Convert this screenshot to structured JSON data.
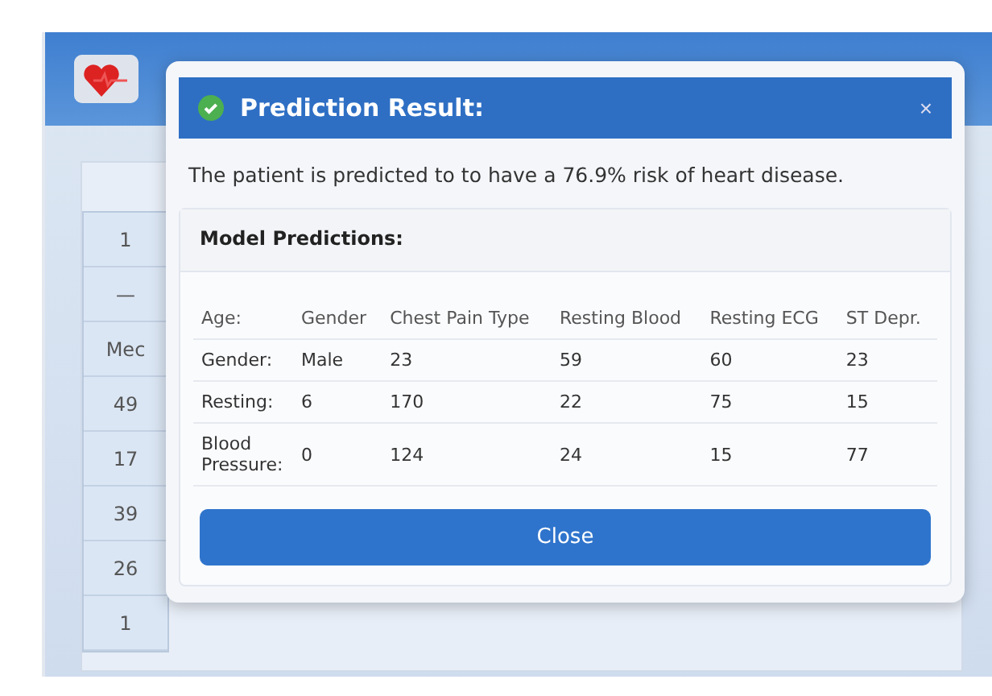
{
  "background_table": {
    "cells": [
      "1",
      "—",
      "Mec",
      "49",
      "17",
      "39",
      "26",
      "1"
    ]
  },
  "dialog": {
    "title": "Prediction Result:",
    "close_icon": "×",
    "message": "The patient is predicted to to have a 76.9% risk of heart disease.",
    "card_title": "Model Predictions:",
    "rows": [
      {
        "kind": "header",
        "label": "Age:",
        "cells": [
          "Gender",
          "Chest Pain Type",
          "Resting Blood",
          "Resting ECG",
          "ST Depr."
        ]
      },
      {
        "kind": "data",
        "label": "Gender:",
        "cells": [
          "Male",
          "23",
          "59",
          "60",
          "23"
        ]
      },
      {
        "kind": "data",
        "label": "Resting:",
        "cells": [
          "6",
          "170",
          "22",
          "75",
          "15"
        ]
      },
      {
        "kind": "data",
        "label": "Blood Pressure:",
        "cells": [
          "0",
          "124",
          "24",
          "15",
          "77"
        ]
      }
    ],
    "button": "Close"
  }
}
